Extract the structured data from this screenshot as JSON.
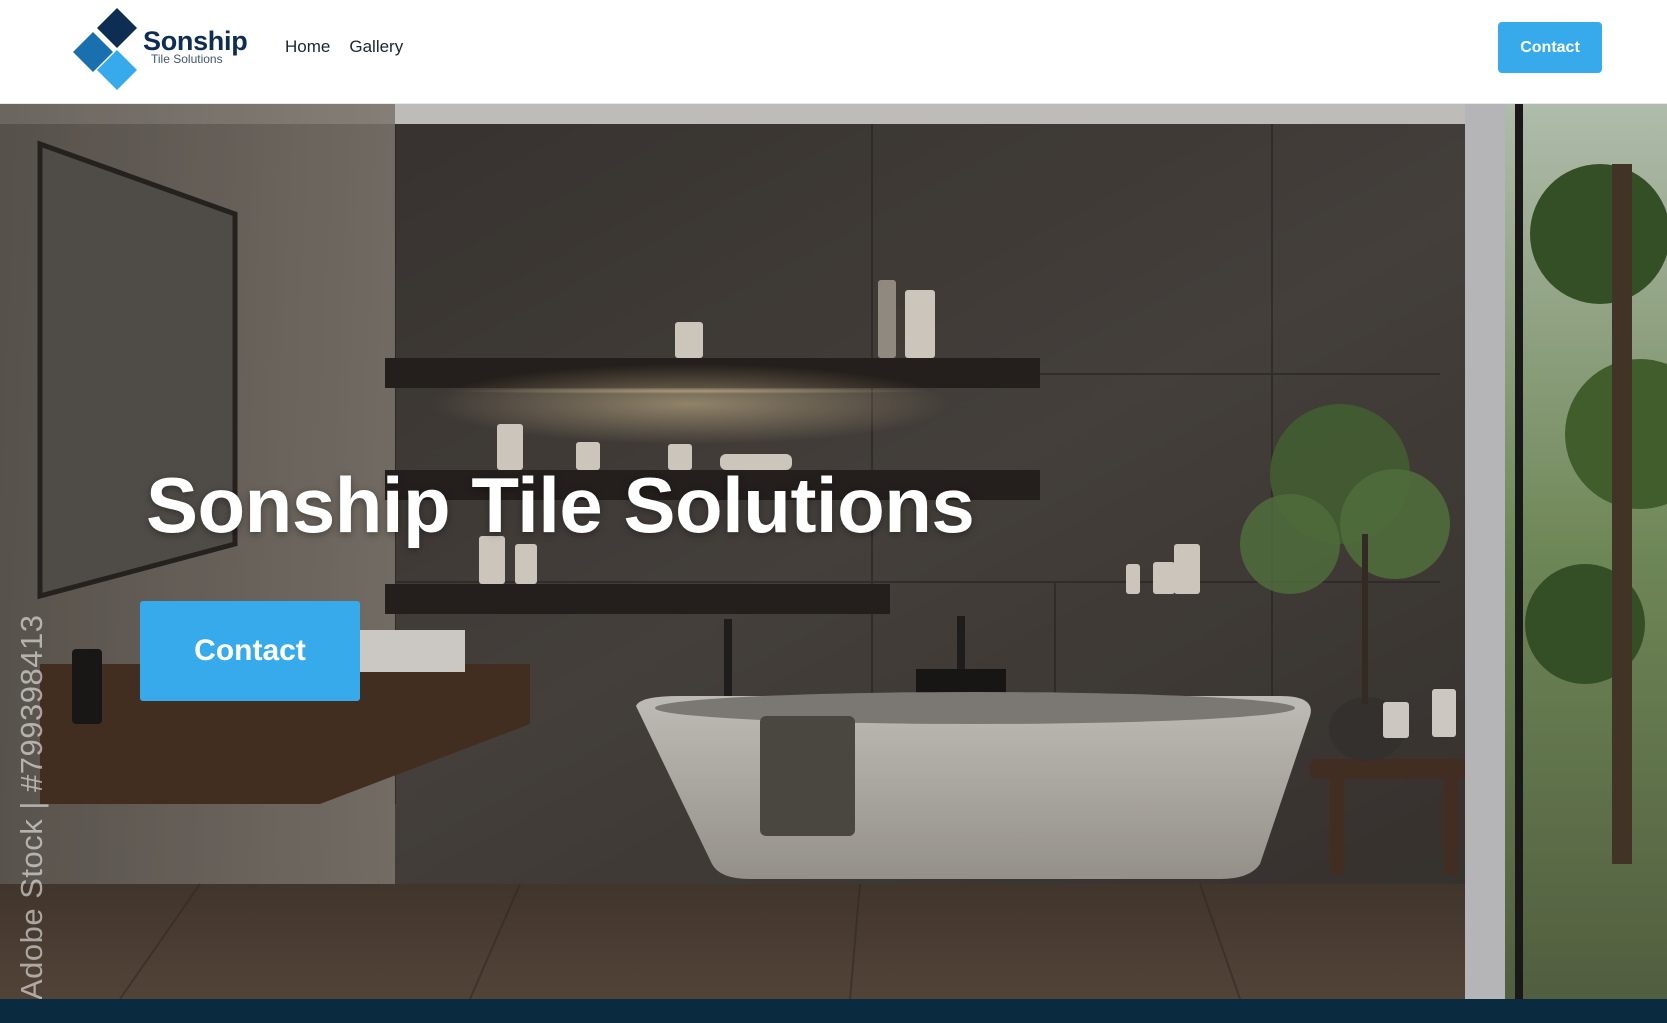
{
  "header": {
    "logo": {
      "name": "Sonship",
      "tagline": "Tile Solutions"
    },
    "nav": [
      {
        "label": "Home"
      },
      {
        "label": "Gallery"
      }
    ],
    "contact_label": "Contact"
  },
  "hero": {
    "title": "Sonship Tile Solutions",
    "cta_label": "Contact",
    "watermark": "Adobe Stock | #799398413"
  },
  "colors": {
    "brand_navy": "#0d2d52",
    "brand_blue": "#1a6fae",
    "accent": "#36aaeb",
    "footer": "#0a2a3f"
  }
}
